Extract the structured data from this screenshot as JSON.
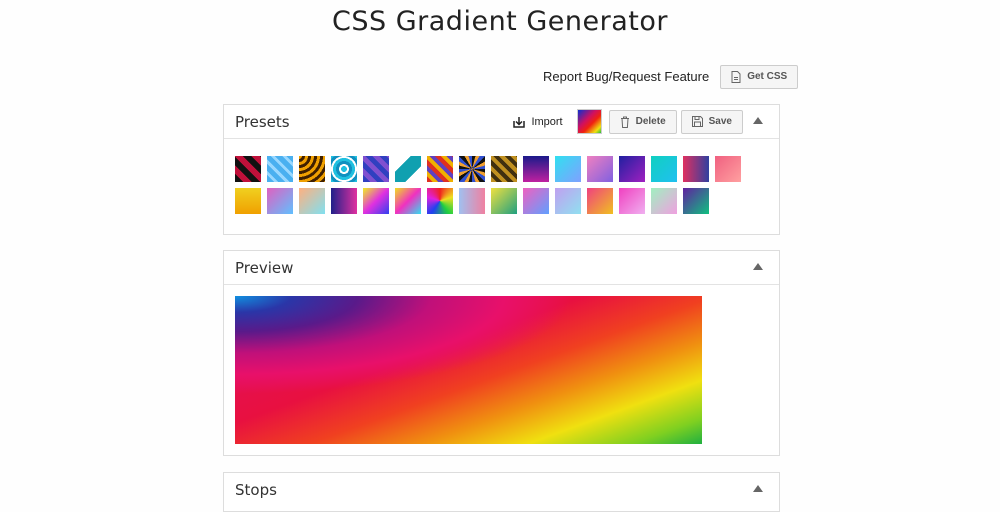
{
  "page": {
    "title": "CSS Gradient Generator"
  },
  "topbar": {
    "report_label": "Report Bug/Request Feature",
    "get_css_label": "Get CSS"
  },
  "presets": {
    "title": "Presets",
    "import_label": "Import",
    "delete_label": "Delete",
    "save_label": "Save",
    "swatches": [
      {
        "bg": "repeating-linear-gradient(45deg,#111 0 6px,#c0103a 6px 12px)"
      },
      {
        "bg": "repeating-linear-gradient(45deg,#4ab0f0 0 5px,#9ad8ff 5px 8px)"
      },
      {
        "bg": "repeating-radial-gradient(circle at 0 0,#f0a000 0 3px,#402000 3px 6px)"
      },
      {
        "bg": "repeating-radial-gradient(circle,#20c0e0 0 3px,#ffffff 3px 5px,#1090c0 5px 8px)"
      },
      {
        "bg": "repeating-linear-gradient(45deg,#3040c0 0 5px,#8050d0 5px 10px)"
      },
      {
        "bg": "linear-gradient(135deg,#ffffff 30%,#10a0b0 30% 70%,#ffffff 70%)"
      },
      {
        "bg": "repeating-linear-gradient(45deg,#e03020 0 4px,#f0b000 4px 8px,#6040c0 8px 12px)"
      },
      {
        "bg": "repeating-conic-gradient(#111 0 15deg,#f0a030 15deg 30deg,#3050d0 30deg 45deg)"
      },
      {
        "bg": "repeating-linear-gradient(45deg,#c09020 0 4px,#403010 4px 8px)"
      },
      {
        "bg": "linear-gradient(180deg,#1a1a8a 0%,#c020a0 100%)"
      },
      {
        "bg": "linear-gradient(135deg,#30e0f0 0%,#80a0ff 100%)"
      },
      {
        "bg": "linear-gradient(135deg,#f080c0 0%,#8060e0 100%)"
      },
      {
        "bg": "linear-gradient(135deg,#2020a0 0%,#a020c0 100%)"
      },
      {
        "bg": "linear-gradient(135deg,#10d0c0 0%,#20c0f0 100%)"
      },
      {
        "bg": "linear-gradient(90deg,#e03060 0%,#3040a0 100%)"
      },
      {
        "bg": "linear-gradient(135deg,#f06080 0%,#ffa0a0 100%)"
      },
      {
        "bg": "linear-gradient(180deg,#f0d020 0%,#f0a000 100%)"
      },
      {
        "bg": "linear-gradient(135deg,#e060c0 0%,#60c0ff 100%)"
      },
      {
        "bg": "linear-gradient(135deg,#ffb080 0%,#80e0f0 100%)"
      },
      {
        "bg": "linear-gradient(90deg,#20208a 0%,#e030a0 100%)"
      },
      {
        "bg": "linear-gradient(135deg,#f0f020 0%,#e030e0 50%,#3040f0 100%)"
      },
      {
        "bg": "linear-gradient(135deg,#f0e020 0%,#f030c0 50%,#30e0f0 100%)"
      },
      {
        "bg": "conic-gradient(#f02020,#f0e020,#20d040,#2040f0,#e020e0,#f02020)"
      },
      {
        "bg": "linear-gradient(90deg,#a0c0f0 0%,#f080a0 100%)"
      },
      {
        "bg": "linear-gradient(135deg,#f0e040 0%,#20a080 100%)"
      },
      {
        "bg": "linear-gradient(135deg,#f060c0 0%,#60a0ff 100%)"
      },
      {
        "bg": "linear-gradient(135deg,#c0a0f0 0%,#90e0f0 100%)"
      },
      {
        "bg": "linear-gradient(135deg,#f04080 0%,#f0c020 100%)"
      },
      {
        "bg": "linear-gradient(135deg,#f040c0 0%,#f0b0f0 100%)"
      },
      {
        "bg": "linear-gradient(135deg,#a0f0c0 0%,#f0a0e0 100%)"
      },
      {
        "bg": "linear-gradient(135deg,#6020a0 0%,#10c080 100%)"
      }
    ]
  },
  "preview": {
    "title": "Preview"
  },
  "stops": {
    "title": "Stops"
  }
}
